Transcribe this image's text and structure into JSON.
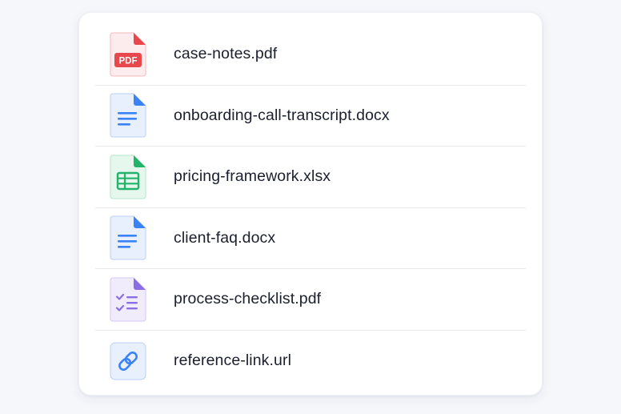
{
  "files": [
    {
      "name": "case-notes.pdf",
      "icon": "pdf-file-icon",
      "badge": "PDF",
      "accent": "#e8474c",
      "tint": "#fdeced"
    },
    {
      "name": "onboarding-call-transcript.docx",
      "icon": "doc-file-icon",
      "accent": "#3b82f6",
      "tint": "#e8f0fd"
    },
    {
      "name": "pricing-framework.xlsx",
      "icon": "spreadsheet-file-icon",
      "accent": "#22b36a",
      "tint": "#e6f7ee"
    },
    {
      "name": "client-faq.docx",
      "icon": "doc-file-icon",
      "accent": "#3b82f6",
      "tint": "#e8f0fd"
    },
    {
      "name": "process-checklist.pdf",
      "icon": "checklist-file-icon",
      "accent": "#8b6ee6",
      "tint": "#f0ecfc"
    },
    {
      "name": "reference-link.url",
      "icon": "link-icon",
      "accent": "#3b82f6",
      "tint": "#e8f0fd"
    }
  ]
}
